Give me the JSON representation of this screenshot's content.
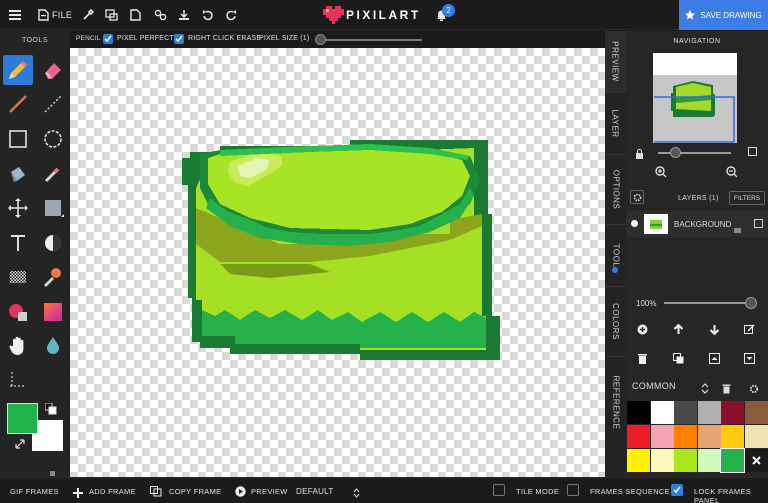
{
  "app": {
    "name": "PIXILART"
  },
  "topbar": {
    "file_label": "FILE",
    "notification_count": "2",
    "save_label": "SAVE DRAWING"
  },
  "toolbar": {
    "title": "TOOLS"
  },
  "colors": {
    "primary": "#22b24c",
    "secondary": "#ffffff",
    "accent": "#3d7de6"
  },
  "tool_options": {
    "tool_name": "PENCIL",
    "pixel_perfect_label": "PIXEL PERFECT",
    "pixel_perfect_checked": true,
    "right_click_erase_label": "RIGHT CLICK ERASE",
    "right_click_erase_checked": true,
    "pixel_size_label": "PIXEL SIZE (1)",
    "pixel_size": 1
  },
  "side_tabs": [
    "PREVIEW",
    "LAYER",
    "OPTIONS",
    "TOOL",
    "COLORS",
    "REFERENCE"
  ],
  "navigation": {
    "title": "NAVIGATION"
  },
  "layers": {
    "title": "LAYERS (1)",
    "filters_label": "FILTERS",
    "items": [
      {
        "name": "BACKGROUND"
      }
    ]
  },
  "opacity": {
    "label": "100%",
    "value": 100
  },
  "palette": {
    "name": "COMMON",
    "swatches": [
      "#000000",
      "#ffffff",
      "#4a4a4a",
      "#b0b0b0",
      "#8b0e2e",
      "#8b5a3c",
      "#ee1c24",
      "#f5a3b1",
      "#ff7f00",
      "#e6a474",
      "#ffc90e",
      "#efe4b0",
      "#fff200",
      "#fff9bd",
      "#a8e61d",
      "#d3f9bc",
      "#22b14c",
      "#ffffff"
    ]
  },
  "bottombar": {
    "gif_frames_label": "GIF FRAMES",
    "add_frame_label": "ADD FRAME",
    "copy_frame_label": "COPY FRAME",
    "preview_label": "PREVIEW",
    "speed_value": "DEFAULT",
    "tile_mode_label": "TILE MODE",
    "tile_mode_checked": false,
    "frames_sequence_label": "FRAMES SEQUENCE",
    "frames_sequence_checked": false,
    "lock_frames_label": "LOCK FRAMES PANEL",
    "lock_frames_checked": true
  }
}
